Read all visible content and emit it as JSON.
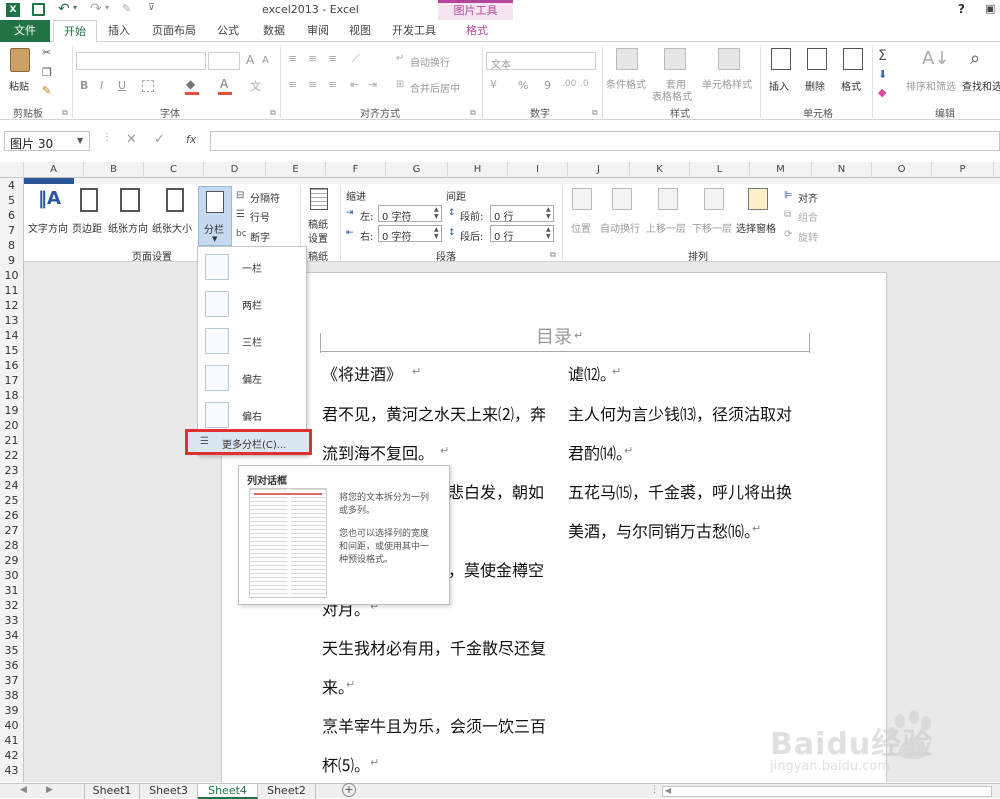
{
  "window": {
    "title": "excel2013 - Excel",
    "context_group": "图片工具",
    "help": "?"
  },
  "tabs": [
    "文件",
    "开始",
    "插入",
    "页面布局",
    "公式",
    "数据",
    "审阅",
    "视图",
    "开发工具",
    "格式"
  ],
  "ribbon": {
    "clipboard": {
      "paste": "粘贴",
      "label": "剪贴板"
    },
    "font": {
      "label": "字体",
      "size_up": "A",
      "size_down": "A",
      "bold": "B",
      "italic": "I",
      "underline": "U"
    },
    "alignment": {
      "wrap": "自动换行",
      "merge": "合并后居中",
      "label": "对齐方式"
    },
    "number": {
      "format": "文本",
      "percent": "%",
      "comma": "9",
      "label": "数字"
    },
    "styles": {
      "conditional": "条件格式",
      "table1": "套用",
      "table2": "表格格式",
      "cell": "单元格样式",
      "label": "样式"
    },
    "cells": {
      "insert": "插入",
      "delete": "删除",
      "format": "格式",
      "label": "单元格"
    },
    "editing": {
      "sort": "排序和筛选",
      "find": "查找和选",
      "label": "编辑"
    }
  },
  "formula_bar": {
    "name_box": "图片 30",
    "fx": "fx"
  },
  "columns": [
    "A",
    "B",
    "C",
    "D",
    "E",
    "F",
    "G",
    "H",
    "I",
    "J",
    "K",
    "L",
    "M",
    "N",
    "O",
    "P"
  ],
  "rows": [
    "4",
    "5",
    "6",
    "7",
    "8",
    "9",
    "10",
    "11",
    "12",
    "13",
    "14",
    "15",
    "16",
    "17",
    "18",
    "19",
    "20",
    "21",
    "22",
    "23",
    "24",
    "25",
    "26",
    "27",
    "28",
    "29",
    "30",
    "31",
    "32",
    "33",
    "34",
    "35",
    "36",
    "37",
    "38",
    "39",
    "40",
    "41",
    "42",
    "43"
  ],
  "sheets": [
    "Sheet1",
    "Sheet3",
    "Sheet4",
    "Sheet2"
  ],
  "active_sheet": "Sheet4",
  "word": {
    "page_setup": {
      "text_dir": "文字方向",
      "margins": "页边距",
      "orientation": "纸张方向",
      "size": "纸张大小",
      "columns": "分栏",
      "breaks": "分隔符",
      "line_numbers": "行号",
      "hyphenation": "断字",
      "label": "页面设置"
    },
    "draft": {
      "btn1": "稿纸",
      "btn2": "设置",
      "label": "稿纸"
    },
    "paragraph": {
      "indent": "缩进",
      "spacing": "间距",
      "left": "左:",
      "right": "右:",
      "before": "段前:",
      "after": "段后:",
      "left_val": "0 字符",
      "right_val": "0 字符",
      "before_val": "0 行",
      "after_val": "0 行",
      "label": "段落"
    },
    "arrange": {
      "position": "位置",
      "wrap": "自动换行",
      "forward": "上移一层",
      "backward": "下移一层",
      "pane": "选择窗格",
      "align": "对齐",
      "group": "组合",
      "rotate": "旋转",
      "label": "排列"
    }
  },
  "column_menu": {
    "items": [
      "一栏",
      "两栏",
      "三栏",
      "偏左",
      "偏右"
    ],
    "more": "更多分栏(C)..."
  },
  "tooltip": {
    "title": "列对话框",
    "line1": "将您的文本拆分为一列",
    "line2": "或多列。",
    "line3": "您也可以选择列的宽度",
    "line4": "和间距，或使用其中一",
    "line5": "种预设格式。"
  },
  "document": {
    "heading": "目录",
    "left": [
      "《将进酒》",
      "君不见，黄河之水天上来⑵，奔",
      "流到海不复回。",
      "悲白发，朝如",
      "，莫使金樽空",
      "对月。",
      "天生我材必有用，千金散尽还复",
      "来。",
      "烹羊宰牛且为乐，会须一饮三百",
      "杯⑸。"
    ],
    "right": [
      "谑⑿。",
      "主人何为言少钱⒀，径须沽取对",
      "君酌⒁。",
      "五花马⒂，千金裘，呼儿将出换",
      "美酒，与尔同销万古愁⒃。"
    ]
  },
  "watermark": {
    "brand": "Baidu经验",
    "url": "jingyan.baidu.com"
  },
  "colors": {
    "accent": "#217346",
    "picture_tools": "#b4479d",
    "highlight_red": "#e0302f"
  }
}
